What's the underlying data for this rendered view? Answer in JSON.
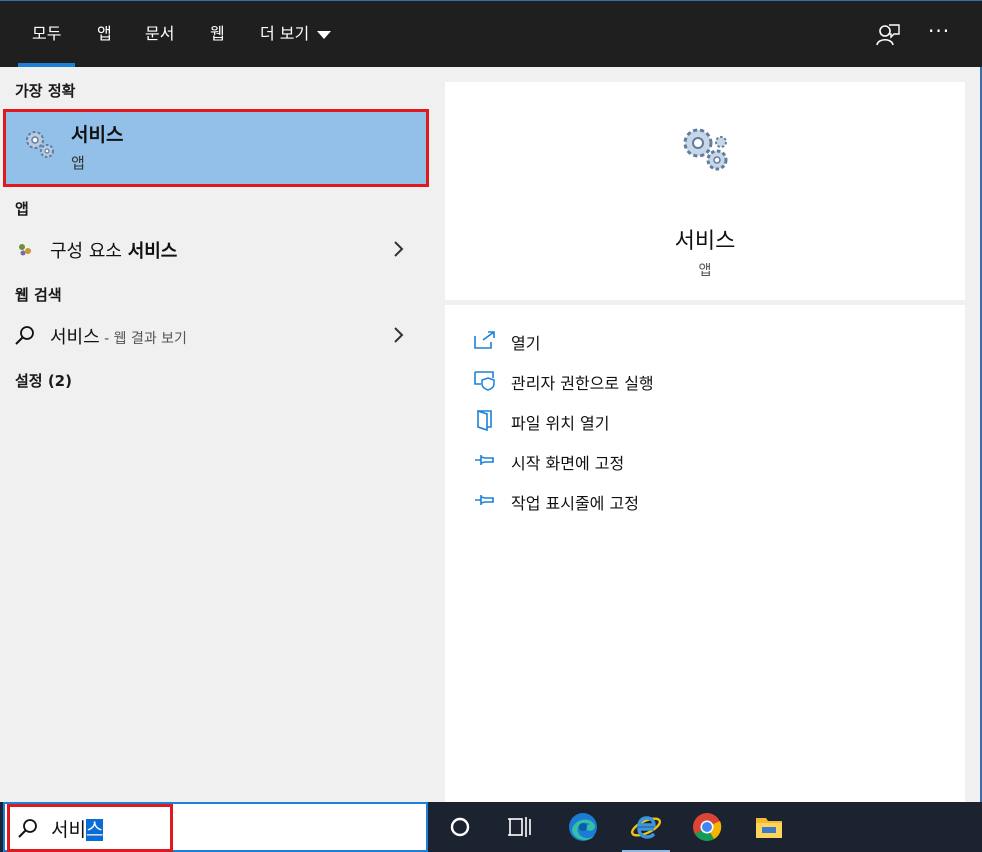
{
  "tabs": [
    {
      "label": "모두",
      "active": true
    },
    {
      "label": "앱"
    },
    {
      "label": "문서"
    },
    {
      "label": "웹"
    },
    {
      "label": "더 보기"
    }
  ],
  "top_icons": [
    "feedback-icon",
    "more-options-icon"
  ],
  "more_label": "···",
  "left": {
    "best_match_header": "가장 정확",
    "best_match": {
      "title": "서비스",
      "subtitle": "앱",
      "icon": "services-gears-icon"
    },
    "apps_header": "앱",
    "app_item": {
      "prefix": "구성 요소 ",
      "bold": "서비스",
      "icon": "component-services-icon"
    },
    "web_header": "웹 검색",
    "web_item": {
      "query": "서비스",
      "suffix": " - 웹 결과 보기",
      "icon": "search-icon"
    },
    "settings_header": "설정 (2)"
  },
  "right": {
    "app_title": "서비스",
    "app_subtitle": "앱",
    "actions": [
      {
        "label": "열기",
        "icon": "open-icon"
      },
      {
        "label": "관리자 권한으로 실행",
        "icon": "shield-icon"
      },
      {
        "label": "파일 위치 열기",
        "icon": "file-location-icon"
      },
      {
        "label": "시작 화면에 고정",
        "icon": "pin-icon"
      },
      {
        "label": "작업 표시줄에 고정",
        "icon": "pin-icon"
      }
    ]
  },
  "search": {
    "typed": "서비",
    "selected": "스"
  },
  "taskbar_icons": [
    "cortana-icon",
    "task-view-icon",
    "edge-icon",
    "internet-explorer-icon",
    "chrome-icon",
    "file-explorer-icon"
  ],
  "colors": {
    "accent": "#1c80d8",
    "highlight": "#92c0e8",
    "annotation": "#e0191f"
  }
}
